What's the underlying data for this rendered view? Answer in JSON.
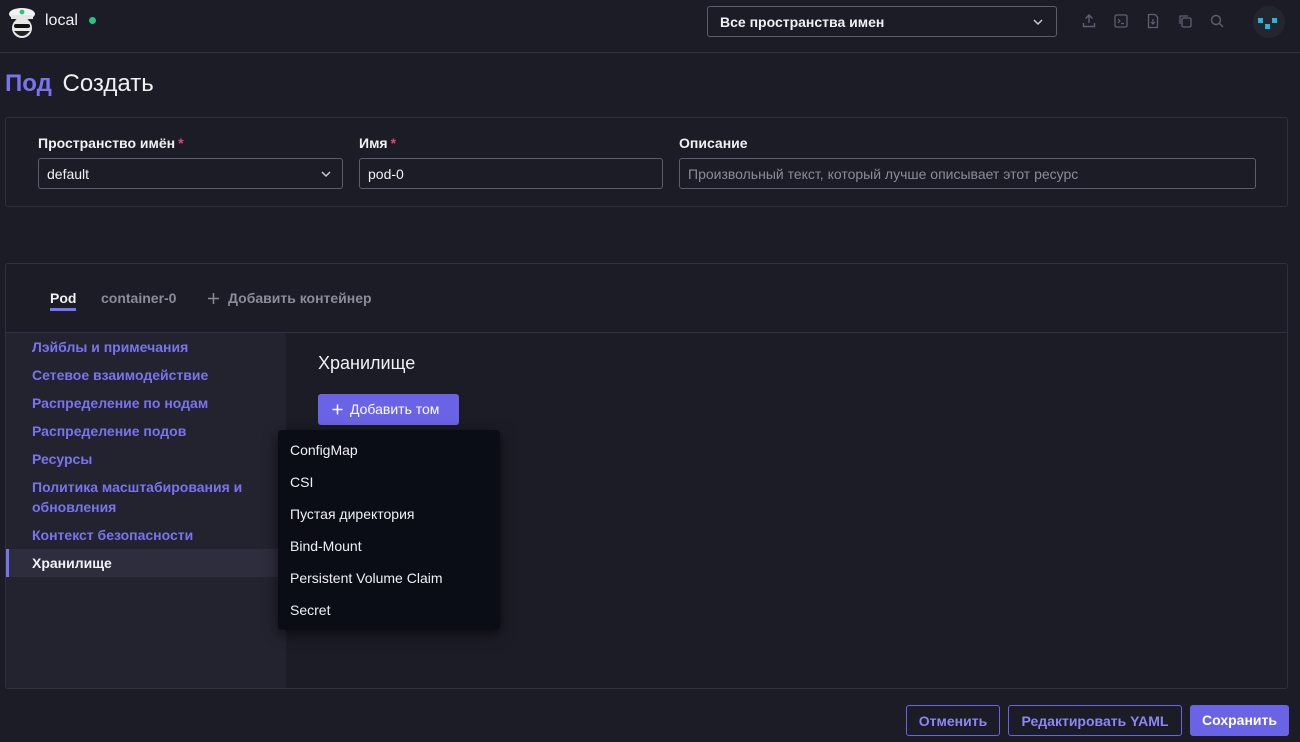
{
  "header": {
    "cluster_name": "local",
    "namespace_selector": "Все пространства имен",
    "icons": [
      "upload-icon",
      "terminal-icon",
      "download-file-icon",
      "copy-icon",
      "search-icon"
    ],
    "status_color": "#2ec27e"
  },
  "page": {
    "resource": "Под",
    "action": "Создать"
  },
  "form": {
    "namespace_label": "Пространство имён",
    "namespace_value": "default",
    "name_label": "Имя",
    "name_value": "pod-0",
    "description_label": "Описание",
    "description_placeholder": "Произвольный текст, который лучше описывает этот ресурс",
    "required_mark": "*"
  },
  "tabs": [
    {
      "label": "Pod",
      "active": true
    },
    {
      "label": "container-0",
      "active": false
    },
    {
      "label": "Добавить контейнер",
      "active": false
    }
  ],
  "sidebar": {
    "items": [
      {
        "label": "Лэйблы и примечания"
      },
      {
        "label": "Сетевое взаимодействие"
      },
      {
        "label": "Распределение по нодам"
      },
      {
        "label": "Распределение подов"
      },
      {
        "label": "Ресурсы"
      },
      {
        "label": "Политика масштабирования и обновления"
      },
      {
        "label": "Контекст безопасности"
      },
      {
        "label": "Хранилище"
      }
    ],
    "active_index": 7
  },
  "storage": {
    "title": "Хранилище",
    "add_volume_label": "Добавить том",
    "options": [
      "ConfigMap",
      "CSI",
      "Пустая директория",
      "Bind-Mount",
      "Persistent Volume Claim",
      "Secret"
    ]
  },
  "footer": {
    "cancel": "Отменить",
    "edit_yaml": "Редактировать YAML",
    "save": "Сохранить"
  },
  "colors": {
    "accent": "#6b63e6",
    "link": "#7a73f0",
    "required": "#e0447a"
  }
}
